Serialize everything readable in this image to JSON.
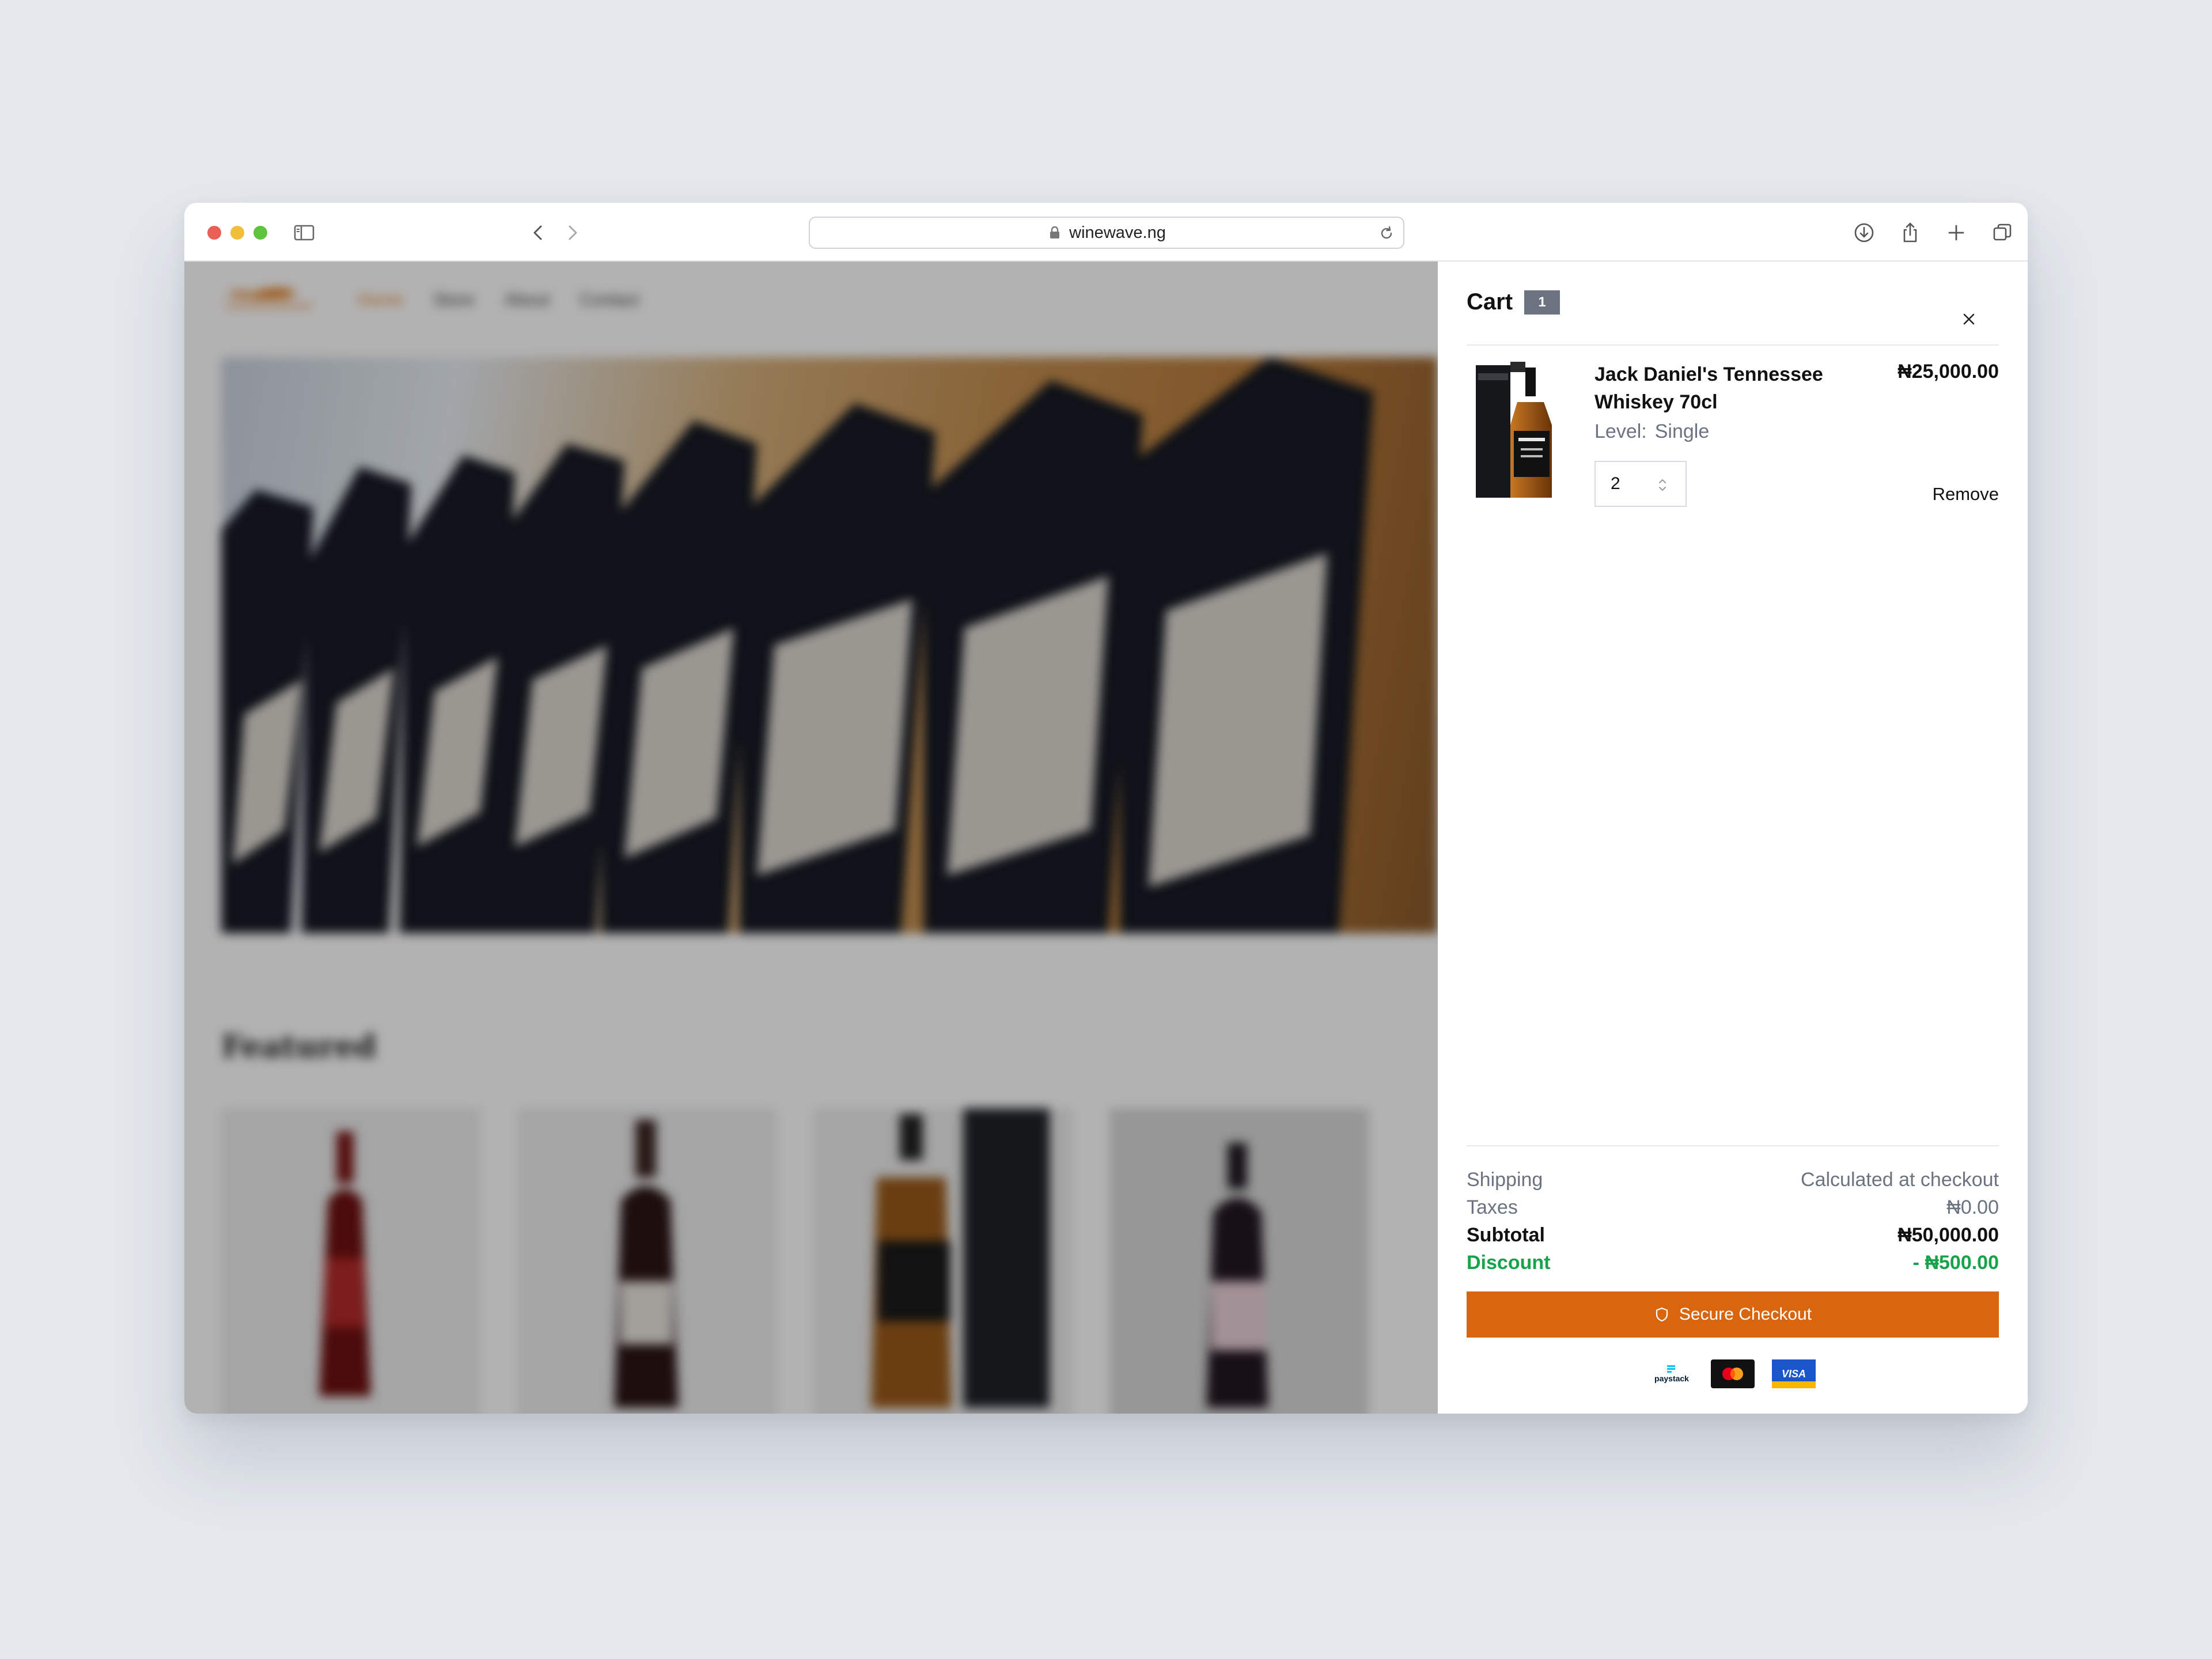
{
  "browser": {
    "url": "winewave.ng"
  },
  "site": {
    "nav": [
      "Home",
      "Store",
      "About",
      "Contact"
    ],
    "featured_title": "Featured"
  },
  "cart": {
    "title": "Cart",
    "count": "1",
    "item": {
      "name": "Jack Daniel's Tennessee Whiskey 70cl",
      "price": "₦25,000.00",
      "level_label": "Level:",
      "level_value": "Single",
      "quantity": "2",
      "remove_label": "Remove"
    },
    "summary": {
      "shipping_label": "Shipping",
      "shipping_value": "Calculated at checkout",
      "taxes_label": "Taxes",
      "taxes_value": "₦0.00",
      "subtotal_label": "Subtotal",
      "subtotal_value": "₦50,000.00",
      "discount_label": "Discount",
      "discount_value": "- ₦500.00"
    },
    "checkout_label": "Secure Checkout",
    "payment_methods": {
      "paystack": "paystack",
      "visa": "VISA"
    }
  },
  "colors": {
    "accent": "#d9650f",
    "discount": "#16a34a",
    "badge": "#6b7280"
  }
}
